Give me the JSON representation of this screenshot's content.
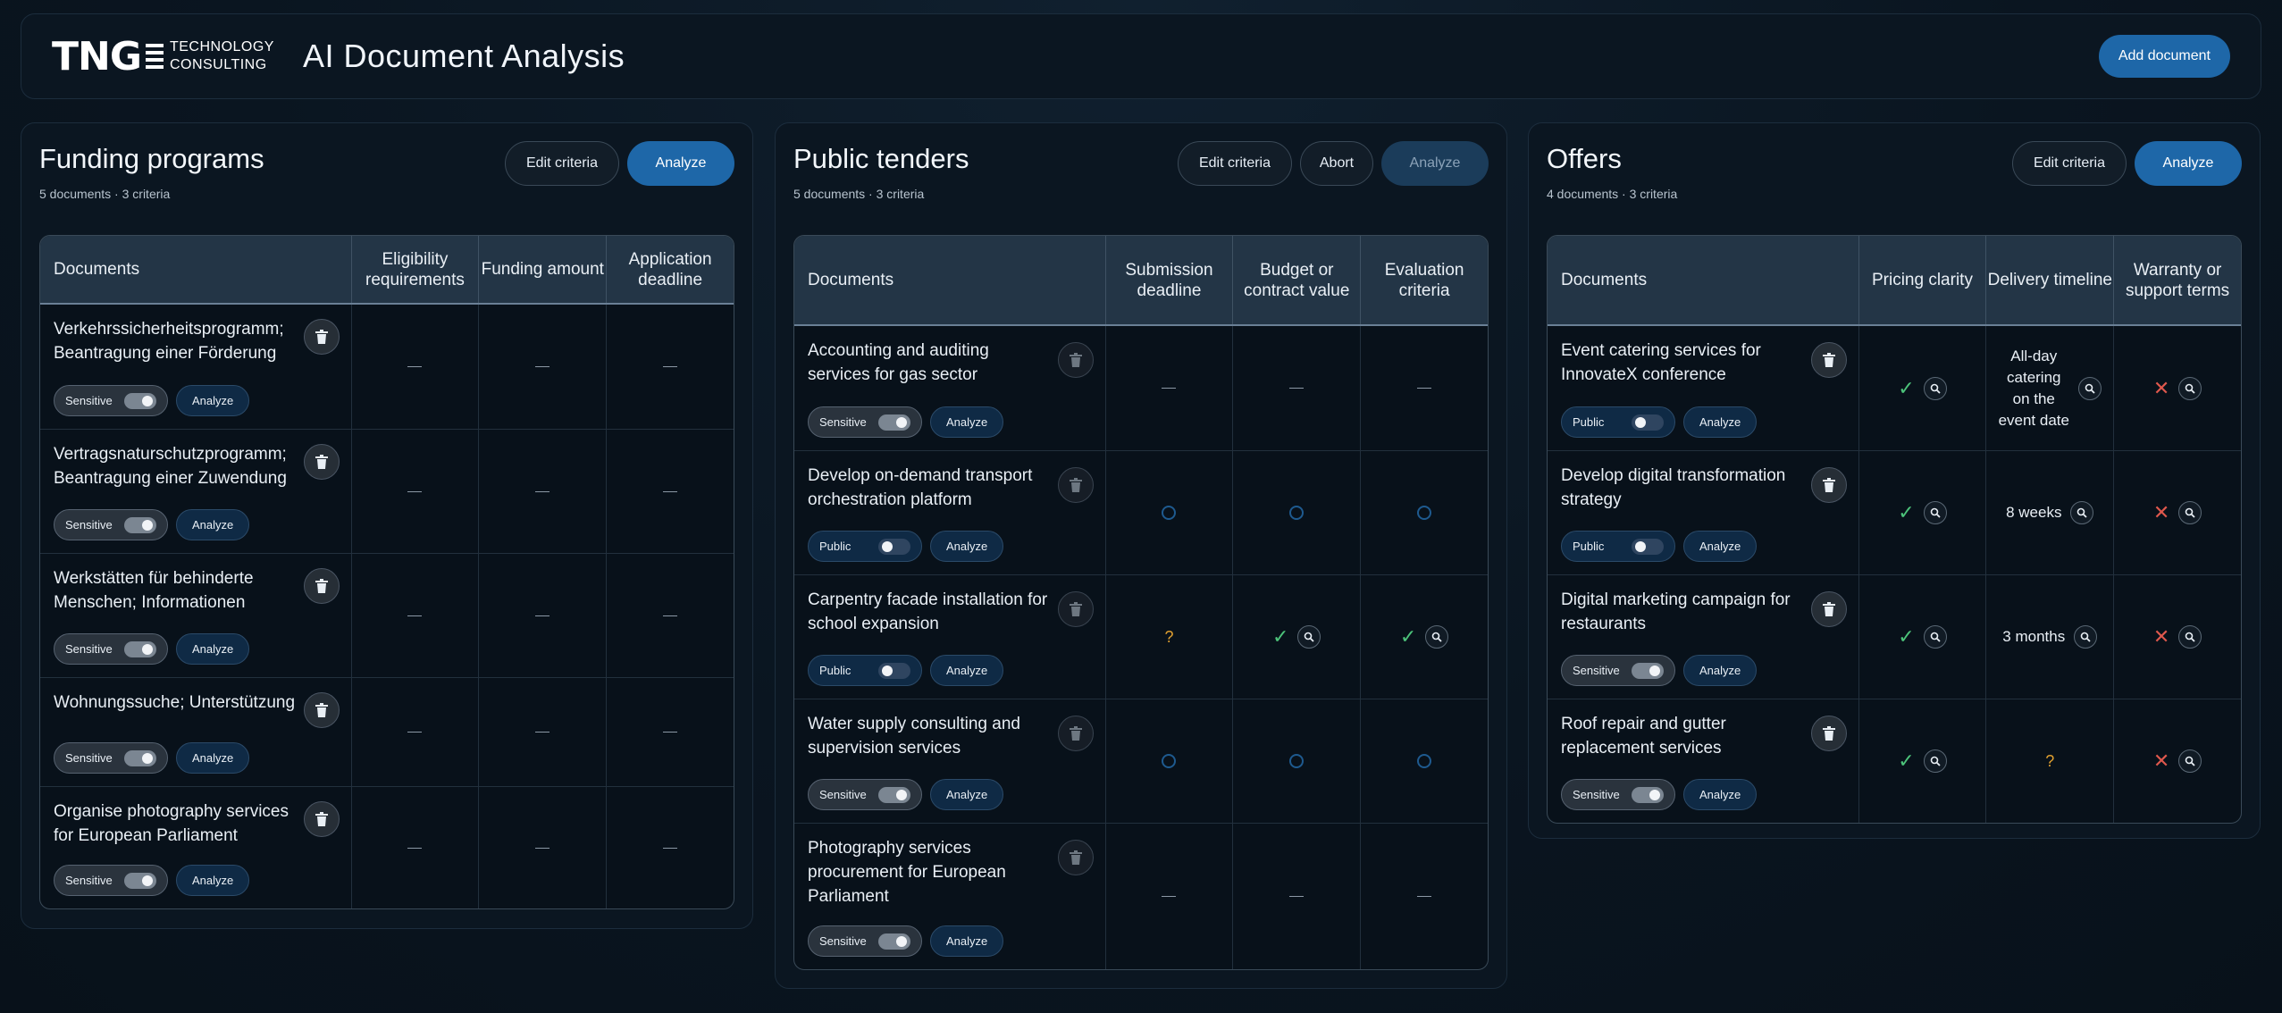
{
  "header": {
    "logo_main": "TNG",
    "logo_sub_1": "TECHNOLOGY",
    "logo_sub_2": "CONSULTING",
    "title": "AI Document Analysis",
    "add_document": "Add document"
  },
  "funding": {
    "title": "Funding programs",
    "subtitle": "5 documents · 3 criteria",
    "edit": "Edit criteria",
    "analyze": "Analyze",
    "col_docs": "Documents",
    "criteria": [
      "Eligibility requirements",
      "Funding amount",
      "Application deadline"
    ],
    "rows": [
      {
        "name": "Verkehrssicherheitsprogramm; Beantragung einer Förderung",
        "visibility": "Sensitive",
        "analyze": "Analyze"
      },
      {
        "name": "Vertragsnaturschutzprogramm; Beantragung einer Zuwendung",
        "visibility": "Sensitive",
        "analyze": "Analyze"
      },
      {
        "name": "Werkstätten für behinderte Menschen; Informationen",
        "visibility": "Sensitive",
        "analyze": "Analyze"
      },
      {
        "name": "Wohnungssuche; Unterstützung",
        "visibility": "Sensitive",
        "analyze": "Analyze"
      },
      {
        "name": "Organise photography services for European Parliament",
        "visibility": "Sensitive",
        "analyze": "Analyze"
      }
    ]
  },
  "tenders": {
    "title": "Public tenders",
    "subtitle": "5 documents · 3 criteria",
    "edit": "Edit criteria",
    "abort": "Abort",
    "analyze": "Analyze",
    "col_docs": "Documents",
    "criteria": [
      "Submission deadline",
      "Budget or contract value",
      "Evaluation criteria"
    ],
    "rows": [
      {
        "name": "Accounting and auditing services for gas sector",
        "visibility": "Sensitive",
        "analyze": "Analyze"
      },
      {
        "name": "Develop on-demand transport orchestration platform",
        "visibility": "Public",
        "analyze": "Analyze"
      },
      {
        "name": "Carpentry facade installation for school expansion",
        "visibility": "Public",
        "analyze": "Analyze",
        "q": "?"
      },
      {
        "name": "Water supply consulting and supervision services",
        "visibility": "Sensitive",
        "analyze": "Analyze"
      },
      {
        "name": "Photography services procurement for European Parliament",
        "visibility": "Sensitive",
        "analyze": "Analyze"
      }
    ]
  },
  "offers": {
    "title": "Offers",
    "subtitle": "4 documents · 3 criteria",
    "edit": "Edit criteria",
    "analyze": "Analyze",
    "col_docs": "Documents",
    "criteria": [
      "Pricing clarity",
      "Delivery timeline",
      "Warranty or support terms"
    ],
    "rows": [
      {
        "name": "Event catering services for InnovateX conference",
        "visibility": "Public",
        "analyze": "Analyze",
        "delivery": "All-day catering on the event date"
      },
      {
        "name": "Develop digital transformation strategy",
        "visibility": "Public",
        "analyze": "Analyze",
        "delivery": "8 weeks"
      },
      {
        "name": "Digital marketing campaign for restaurants",
        "visibility": "Sensitive",
        "analyze": "Analyze",
        "delivery": "3 months"
      },
      {
        "name": "Roof repair and gutter replacement services",
        "visibility": "Sensitive",
        "analyze": "Analyze",
        "delivery": "?"
      }
    ]
  },
  "colors": {
    "accent": "#1e67a8",
    "background": "#0a1520",
    "check": "#4cc37a",
    "cross": "#e0584d",
    "unknown": "#e0a030"
  }
}
